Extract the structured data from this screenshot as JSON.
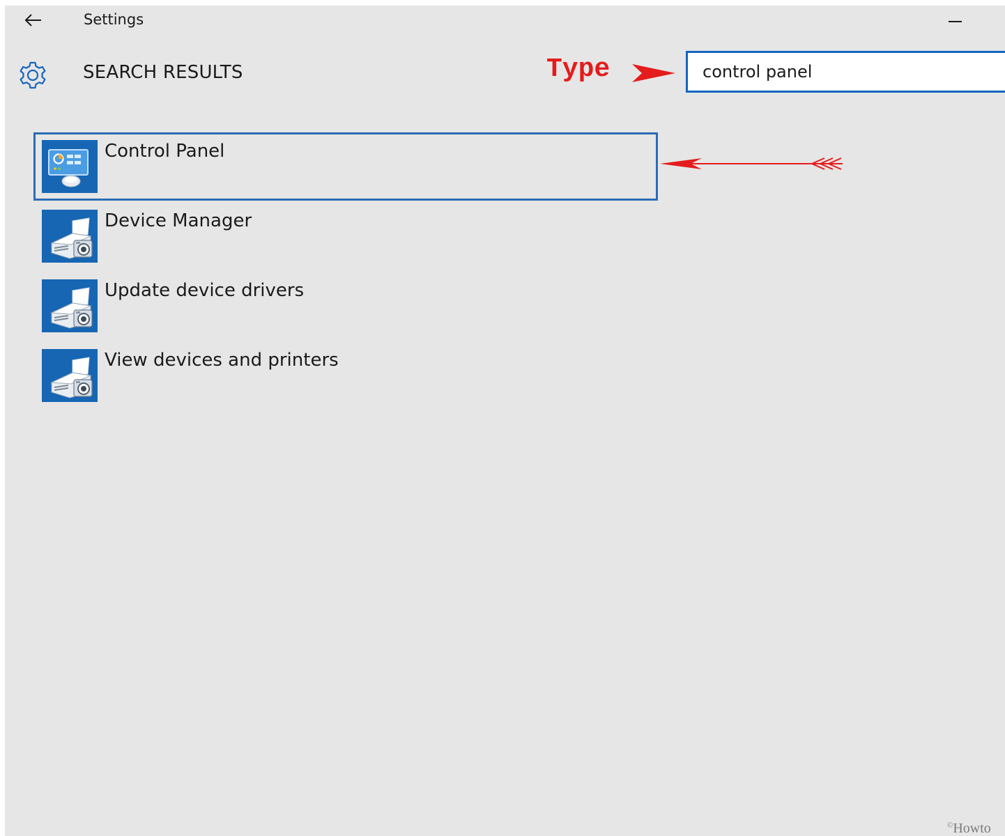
{
  "window": {
    "title": "Settings",
    "background_color": "#e6e6e6"
  },
  "titlebar": {
    "back_icon": "arrow-left-icon",
    "minimize_icon": "minimize-icon"
  },
  "header": {
    "icon": "gear-icon",
    "title": "SEARCH RESULTS",
    "accent_color": "#1565c0"
  },
  "annotation": {
    "type_label": "Type",
    "color": "#e51c1c"
  },
  "search": {
    "value": "control panel"
  },
  "results": [
    {
      "label": "Control Panel",
      "icon": "control-panel-icon",
      "selected": true
    },
    {
      "label": "Device Manager",
      "icon": "devices-printer-icon",
      "selected": false
    },
    {
      "label": "Update device drivers",
      "icon": "devices-printer-icon",
      "selected": false
    },
    {
      "label": "View devices and printers",
      "icon": "devices-printer-icon",
      "selected": false
    }
  ],
  "watermark": {
    "symbol": "©",
    "text": "Howto"
  }
}
